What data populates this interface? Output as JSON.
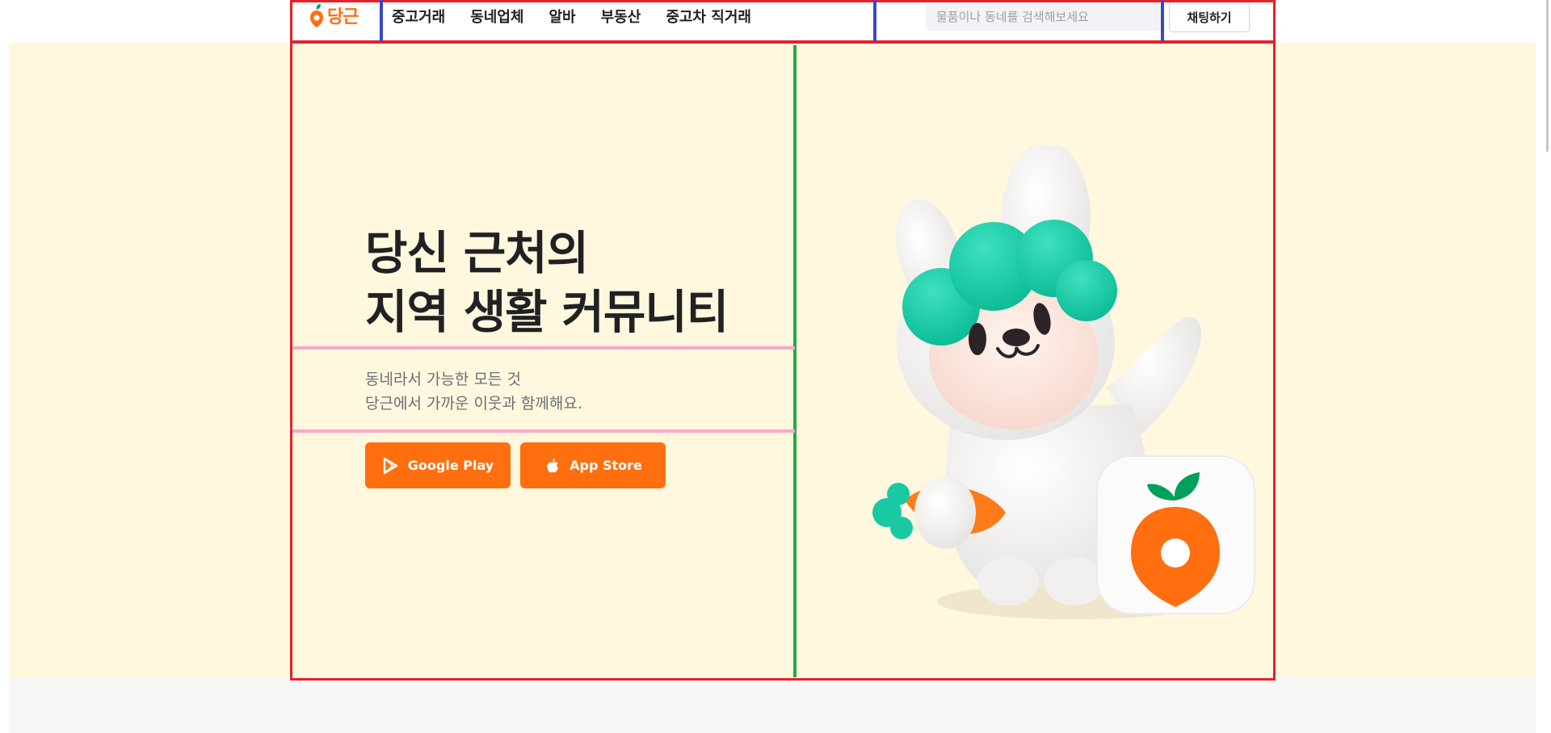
{
  "header": {
    "logo_text": "당근",
    "nav": [
      "중고거래",
      "동네업체",
      "알바",
      "부동산",
      "중고차 직거래"
    ],
    "search_placeholder": "물품이나 동네를 검색해보세요",
    "chat_button": "채팅하기"
  },
  "hero": {
    "title_line1": "당신 근처의",
    "title_line2": "지역 생활 커뮤니티",
    "subtitle_line1": "동네라서 가능한 모든 것",
    "subtitle_line2": "당근에서 가까운 이웃과 함께해요.",
    "google_play": "Google Play",
    "app_store": "App Store"
  },
  "colors": {
    "brand": "#ff6f0f",
    "hero_background": "#fff8de",
    "overlay_red": "#e5212a",
    "overlay_blue": "#3a47c9",
    "overlay_green": "#23a84a",
    "overlay_pink": "#f7a8c8"
  },
  "icons": [
    "carrot-logo-icon",
    "google-play-icon",
    "apple-icon",
    "rabbit-mascot-illustration",
    "carrot-app-icon"
  ]
}
